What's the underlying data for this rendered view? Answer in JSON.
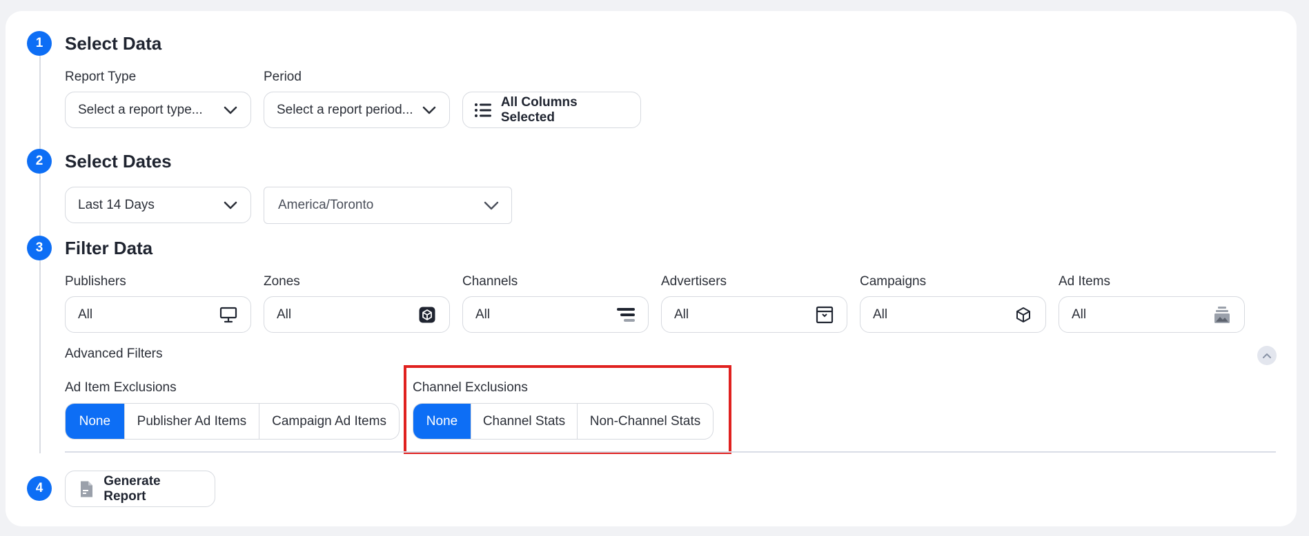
{
  "steps": {
    "select_data": {
      "number": "1",
      "title": "Select Data"
    },
    "select_dates": {
      "number": "2",
      "title": "Select Dates"
    },
    "filter_data": {
      "number": "3",
      "title": "Filter Data"
    },
    "generate": {
      "number": "4"
    }
  },
  "select_data": {
    "report_type_label": "Report Type",
    "report_type_value": "Select a report type...",
    "period_label": "Period",
    "period_value": "Select a report period...",
    "columns_button": "All Columns Selected"
  },
  "select_dates": {
    "range_value": "Last 14 Days",
    "timezone_value": "America/Toronto"
  },
  "filters": [
    {
      "label": "Publishers",
      "value": "All",
      "icon": "monitor-icon"
    },
    {
      "label": "Zones",
      "value": "All",
      "icon": "zone-cube-icon"
    },
    {
      "label": "Channels",
      "value": "All",
      "icon": "channels-icon"
    },
    {
      "label": "Advertisers",
      "value": "All",
      "icon": "advertiser-icon"
    },
    {
      "label": "Campaigns",
      "value": "All",
      "icon": "campaign-box-icon"
    },
    {
      "label": "Ad Items",
      "value": "All",
      "icon": "ad-items-icon"
    }
  ],
  "advanced": {
    "title": "Advanced Filters",
    "ad_item_exclusions": {
      "label": "Ad Item Exclusions",
      "options": [
        "None",
        "Publisher Ad Items",
        "Campaign Ad Items"
      ],
      "selected": "None"
    },
    "channel_exclusions": {
      "label": "Channel Exclusions",
      "options": [
        "None",
        "Channel Stats",
        "Non-Channel Stats"
      ],
      "selected": "None"
    }
  },
  "generate_button": "Generate Report",
  "colors": {
    "accent": "#0d6ef5",
    "highlight": "#e0211f",
    "background": "#f1f2f5"
  }
}
